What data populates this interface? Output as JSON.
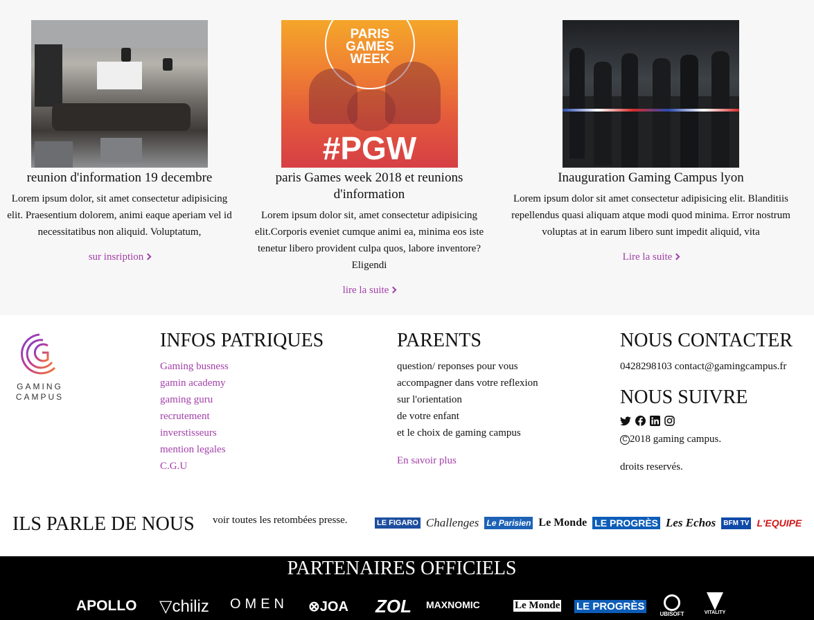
{
  "news": [
    {
      "title": "reunion d'information 19 decembre",
      "text": "Lorem ipsum dolor, sit amet consectetur adipisicing elit. Praesentium dolorem, animi eaque aperiam vel id necessitatibus non aliquid. Voluptatum,",
      "link": "sur insription"
    },
    {
      "title": "paris Games week 2018 et reunions d'information",
      "text": "Lorem ipsum dolor sit, amet consectetur adipisicing elit.Corporis eveniet cumque animi ea, minima eos iste tenetur libero provident culpa quos, labore inventore? Eligendi",
      "link": "lire la suite",
      "image_text_top": "PARIS GAMES WEEK",
      "image_text_bottom": "#PGW"
    },
    {
      "title": "Inauguration Gaming Campus lyon",
      "text": "Lorem ipsum dolor sit amet consectetur adipisicing elit. Blanditiis repellendus quasi aliquam atque modi quod minima. Error nostrum voluptas at in earum libero sunt impedit aliquid, vita",
      "link": "Lire la suite"
    }
  ],
  "brand": {
    "line1": "GAMING",
    "line2": "CAMPUS"
  },
  "infos": {
    "title": "INFOS PATRIQUES",
    "links": [
      "Gaming busness",
      "gamin academy",
      "gaming guru",
      "recrutement",
      "inverstisseurs",
      "mention legales",
      "C.G.U"
    ]
  },
  "parents": {
    "title": "PARENTS",
    "lines": [
      "question/ reponses pour vous",
      "accompagner dans votre reflexion",
      "sur l'orientation",
      "de votre enfant",
      "et le choix de gaming campus"
    ],
    "link": "En savoir plus"
  },
  "contact": {
    "title": "NOUS CONTACTER",
    "phone": "0428298103",
    "email": "contact@gamingcampus.fr",
    "follow_title": "NOUS SUIVRE",
    "copyright": "2018 gaming campus.",
    "rights": "droits reservés.",
    "icons": [
      "twitter-icon",
      "facebook-icon",
      "linkedin-icon",
      "instagram-icon"
    ]
  },
  "press": {
    "title": "ILS PARLE DE NOUS",
    "link": "voir toutes les retombées presse.",
    "logos": [
      "LE FIGARO",
      "Challenges",
      "Le Parisien",
      "Le Monde",
      "LE PROGRÈS",
      "Les Echos",
      "BFM TV",
      "L'EQUIPE"
    ]
  },
  "partners": {
    "title": "PARTENAIRES OFFICIELS",
    "logos": [
      "APOLLO",
      "chiliz",
      "OMEN",
      "JOA",
      "ZOL",
      "MAXNOMIC",
      "Le Monde",
      "LE PROGRÈS",
      "UBISOFT",
      "VITALITY"
    ]
  },
  "colors": {
    "accent": "#a23ea8",
    "footer_black": "#000000",
    "news_bg": "#f7f7f7"
  }
}
